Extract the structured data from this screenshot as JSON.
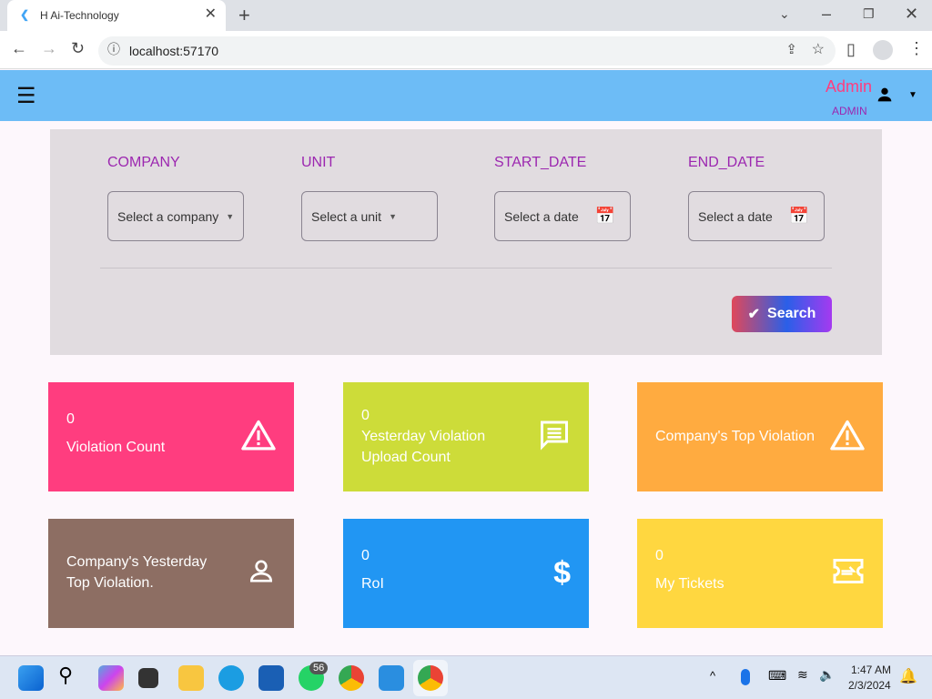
{
  "browser": {
    "tab_title": "H Ai-Technology",
    "url": "localhost:57170"
  },
  "appbar": {
    "user_name": "Admin",
    "user_role": "ADMIN"
  },
  "filters": {
    "company": {
      "label": "COMPANY",
      "placeholder": "Select a company"
    },
    "unit": {
      "label": "UNIT",
      "placeholder": "Select a unit"
    },
    "start_date": {
      "label": "START_DATE",
      "placeholder": "Select a date"
    },
    "end_date": {
      "label": "END_DATE",
      "placeholder": "Select a date"
    },
    "search_label": "Search"
  },
  "cards": [
    {
      "value": "0",
      "label": "Violation Count",
      "color": "#ff3d7f",
      "icon": "warning-icon"
    },
    {
      "value": "0",
      "label": "Yesterday Violation Upload Count",
      "color": "#cddc39",
      "icon": "message-icon"
    },
    {
      "value": "",
      "label": "Company's Top Violation",
      "color": "#ffab40",
      "icon": "warning-icon"
    },
    {
      "value": "",
      "label": "Company's Yesterday Top Violation.",
      "color": "#8d6e63",
      "icon": "person-icon"
    },
    {
      "value": "0",
      "label": "RoI",
      "color": "#2196f3",
      "icon": "dollar-icon"
    },
    {
      "value": "0",
      "label": "My Tickets",
      "color": "#ffd740",
      "icon": "ticket-icon"
    }
  ],
  "taskbar": {
    "whatsapp_badge": "56",
    "time": "1:47 AM",
    "date": "2/3/2024"
  }
}
